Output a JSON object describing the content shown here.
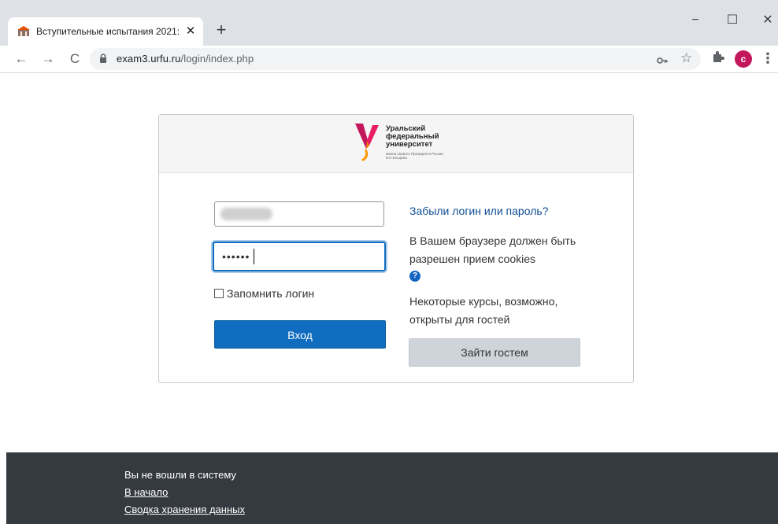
{
  "browser": {
    "tab_title": "Вступительные испытания 2021:",
    "tab_close": "✕",
    "new_tab": "+",
    "url_host": "exam3.urfu.ru",
    "url_path": "/login/index.php",
    "profile_initial": "c",
    "win_min": "−",
    "win_max": "☐",
    "win_close": "✕",
    "back": "←",
    "forward": "→",
    "reload": "C",
    "star": "☆",
    "menu": "⋮"
  },
  "logo": {
    "line1": "Уральский",
    "line2": "федеральный",
    "line3": "университет",
    "sub": "имени первого Президента России Б.Н.Ельцина"
  },
  "form": {
    "password_value": "••••••",
    "remember_label": "Запомнить логин",
    "login_button": "Вход"
  },
  "side": {
    "forgot_link": "Забыли логин или пароль?",
    "cookies_text": "В Вашем браузере должен быть разрешен прием cookies",
    "help_glyph": "?",
    "guest_text": "Некоторые курсы, возможно, открыты для гостей",
    "guest_button": "Зайти гостем"
  },
  "footer": {
    "status": "Вы не вошли в систему",
    "home_link": "В начало",
    "policy_link": "Сводка хранения данных"
  },
  "colors": {
    "primary": "#0f6cbf",
    "footer_bg": "#343a40",
    "secondary_btn": "#ced4da"
  }
}
